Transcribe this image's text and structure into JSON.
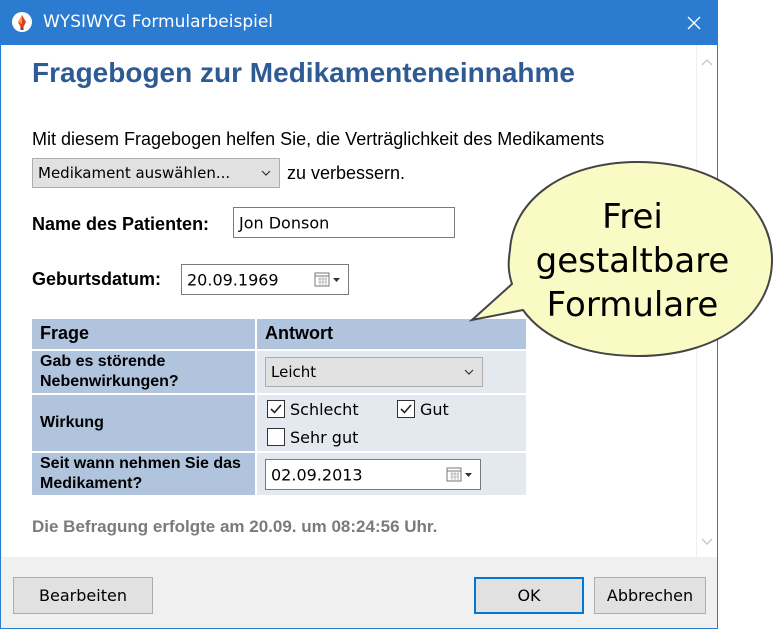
{
  "window": {
    "title": "WYSIWYG Formularbeispiel",
    "accent_color": "#2b7bd1",
    "app_icon": "pen-nib-icon",
    "close_icon": "close-icon"
  },
  "form": {
    "heading": "Fragebogen zur Medikamenteneinnahme",
    "intro_text": "Mit diesem Fragebogen helfen Sie, die Verträglichkeit des Medikaments",
    "medication_combo_value": "Medikament auswählen...",
    "after_combo_text": "zu verbessern.",
    "patient_name_label": "Name des Patienten:",
    "patient_name_value": "Jon Donson",
    "birthdate_label": "Geburtsdatum:",
    "birthdate_value": "20.09.1969",
    "table": {
      "header_question": "Frage",
      "header_answer": "Antwort",
      "rows": [
        {
          "question": "Gab es störende Nebenwirkungen?",
          "answer_value": "Leicht"
        },
        {
          "question": "Wirkung",
          "options": [
            {
              "label": "Schlecht",
              "checked": true
            },
            {
              "label": "Gut",
              "checked": true
            },
            {
              "label": "Sehr gut",
              "checked": false
            }
          ]
        },
        {
          "question": "Seit wann nehmen Sie das Medikament?",
          "answer_value": "02.09.2013"
        }
      ]
    },
    "footer_note": "Die Befragung erfolgte am 20.09. um 08:24:56 Uhr."
  },
  "buttons": {
    "edit": "Bearbeiten",
    "ok": "OK",
    "cancel": "Abbrechen"
  },
  "callout": {
    "text_lines": [
      "Frei",
      "gestaltbare",
      "Formulare"
    ],
    "fill_color": "#fafac4"
  }
}
